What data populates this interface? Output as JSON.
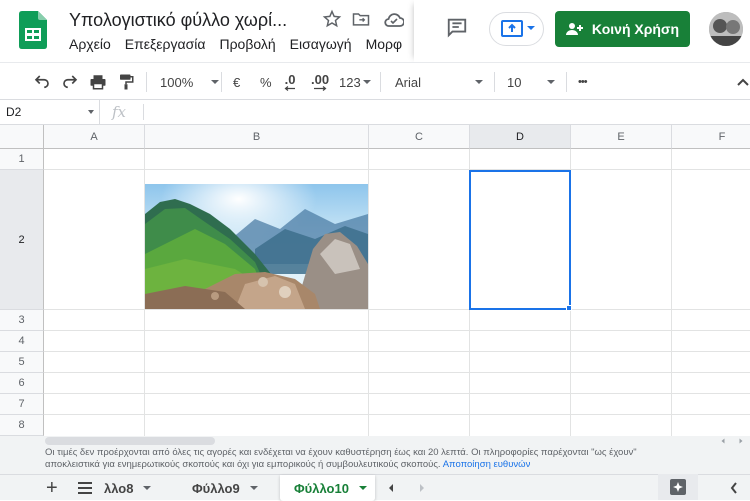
{
  "header": {
    "title": "Υπολογιστικό φύλλο χωρί...",
    "menu": [
      "Αρχείο",
      "Επεξεργασία",
      "Προβολή",
      "Εισαγωγή",
      "Μορφ"
    ],
    "share_label": "Κοινή Χρήση"
  },
  "toolbar": {
    "zoom": "100%",
    "currency": "€",
    "percent": "%",
    "decrease_decimals": ".0",
    "increase_decimals": ".00",
    "number_format": "123",
    "font": "Arial",
    "font_size": "10",
    "more": "•••"
  },
  "formula_bar": {
    "cell_ref": "D2",
    "fx": "fx",
    "value": ""
  },
  "grid": {
    "columns": [
      "A",
      "B",
      "C",
      "D",
      "E",
      "F"
    ],
    "rows": [
      "1",
      "2",
      "3",
      "4",
      "5",
      "6",
      "7",
      "8"
    ],
    "selected_cell": "D2"
  },
  "footer": {
    "disclaimer_line1": "Οι τιμές δεν προέρχονται από όλες τις αγορές και ενδέχεται να έχουν καθυστέρηση έως και 20 λεπτά. Οι πληροφορίες παρέχονται \"ως έχουν\"",
    "disclaimer_line2": "αποκλειστικά για ενημερωτικούς σκοπούς και όχι για εμπορικούς ή συμβουλευτικούς σκοπούς.",
    "disclaimer_link": "Αποποίηση ευθυνών",
    "sheets": [
      "λλο8",
      "Φύλλο9",
      "Φύλλο10"
    ],
    "active_sheet": "Φύλλο10",
    "add_sheet": "+"
  },
  "colors": {
    "accent": "#188038",
    "selection": "#1a73e8"
  }
}
